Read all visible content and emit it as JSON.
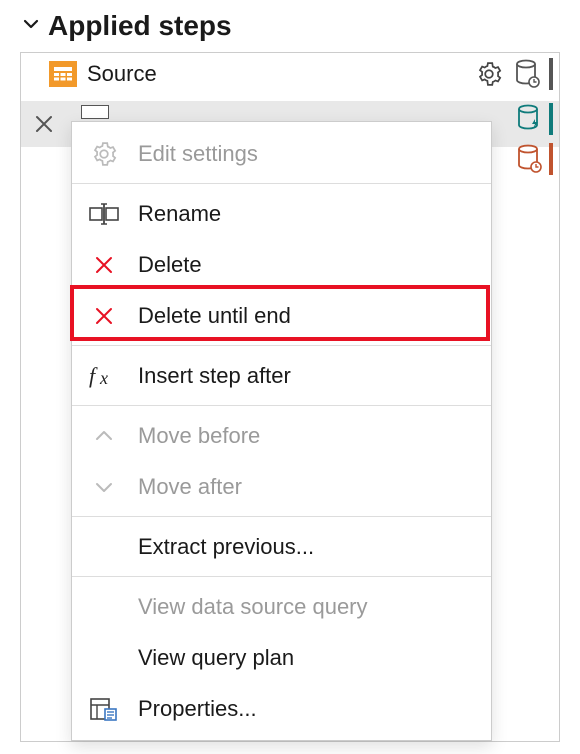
{
  "header": {
    "title": "Applied steps"
  },
  "steps": [
    {
      "label": "Source"
    }
  ],
  "context_menu": {
    "edit_settings": "Edit settings",
    "rename": "Rename",
    "delete": "Delete",
    "delete_until_end": "Delete until end",
    "insert_step_after": "Insert step after",
    "move_before": "Move before",
    "move_after": "Move after",
    "extract_previous": "Extract previous...",
    "view_data_source_query": "View data source query",
    "view_query_plan": "View query plan",
    "properties": "Properties..."
  }
}
